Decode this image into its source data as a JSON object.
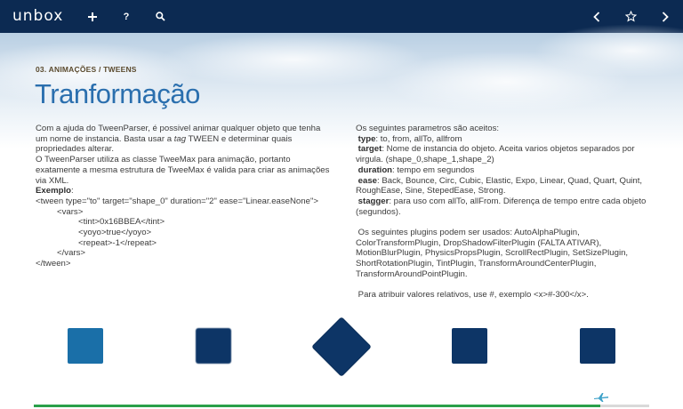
{
  "app": {
    "logo": "unbox"
  },
  "toolbar": {
    "add_icon": "plus-icon",
    "help_label": "?",
    "search_icon": "search-icon",
    "prev_icon": "chevron-left-icon",
    "favorite_icon": "star-icon",
    "next_icon": "chevron-right-icon"
  },
  "header": {
    "section": "03. ANIMAÇÕES / TWEENS",
    "title": "Tranformação"
  },
  "left": {
    "intro_1a": "Com a ajuda do TweenParser, é possivel animar qualquer objeto que tenha um nome de instancia. Basta usar a ",
    "intro_1_tag": "tag",
    "intro_1b": " TWEEN e determinar quais propriedades alterar.",
    "intro_2": "O TweenParser utiliza as classe TweeMax para animação, portanto exatamente a mesma estrutura de TweeMax é valida para criar as animações via XML.",
    "example_label": "Exemplo",
    "example_colon": ":",
    "code": [
      "<tween type=\"to\" target=\"shape_0\" duration=\"2\" ease=\"Linear.easeNone\">",
      "<vars>",
      "<tint>0x16BBEA</tint>",
      "<yoyo>true</yoyo>",
      "<repeat>-1</repeat>",
      "</vars>",
      "</tween>"
    ]
  },
  "right": {
    "params_intro": "Os seguintes parametros são aceitos:",
    "params": [
      {
        "key": "type",
        "desc": ": to, from, allTo, allfrom"
      },
      {
        "key": "target",
        "desc": ": Nome de instancia do objeto. Aceita varios objetos separados por virgula. (shape_0,shape_1,shape_2)"
      },
      {
        "key": "duration",
        "desc": ": tempo em segundos"
      },
      {
        "key": "ease",
        "desc": ": Back, Bounce, Circ, Cubic, Elastic, Expo, Linear, Quad, Quart, Quint, RoughEase, Sine, StepedEase, Strong."
      },
      {
        "key": "stagger",
        "desc": ": para uso com allTo, allFrom. Diferença de tempo entre cada objeto (segundos)."
      }
    ],
    "plugins_text": "Os seguintes plugins podem ser usados: AutoAlphaPlugin, ColorTransformPlugin, DropShadowFilterPlugin (FALTA ATIVAR), MotionBlurPlugin, PhysicsPropsPlugin, ScrollRectPlugin, SetSizePlugin, ShortRotationPlugin, TintPlugin, TransformAroundCenterPlugin, TransformAroundPointPlugin.",
    "relative_text": "Para atribuir valores relativos, use #, exemplo <x>#-300</x>."
  },
  "colors": {
    "topbar": "#0c2a52",
    "title": "#2a6fae",
    "shape_light": "#1a6fa8",
    "shape_dark": "#0d3566",
    "progress": "#2aa04a"
  },
  "progress": {
    "value": 0.92
  },
  "footer": {
    "plane_icon": "airplane-icon"
  }
}
